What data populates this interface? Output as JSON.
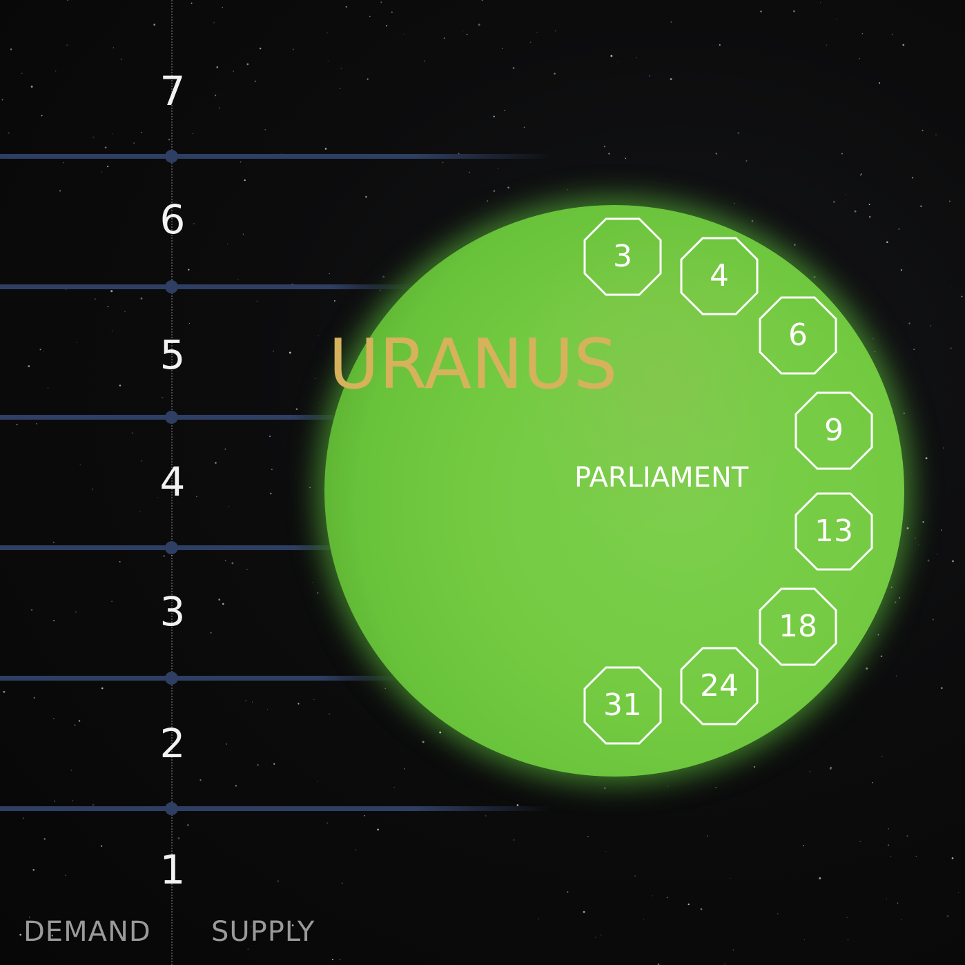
{
  "board": {
    "levels": [
      {
        "label": "7"
      },
      {
        "label": "6"
      },
      {
        "label": "5"
      },
      {
        "label": "4"
      },
      {
        "label": "3"
      },
      {
        "label": "2"
      },
      {
        "label": "1"
      }
    ],
    "demand_label": "DEMAND",
    "supply_label": "SUPPLY"
  },
  "planet": {
    "name": "URANUS",
    "parliament_label": "PARLIAMENT",
    "seats": [
      "3",
      "4",
      "6",
      "9",
      "13",
      "18",
      "24",
      "31"
    ],
    "colors": {
      "planet": "#74cb42",
      "name": "#d6b25c",
      "level_line": "#2f3f63"
    }
  }
}
